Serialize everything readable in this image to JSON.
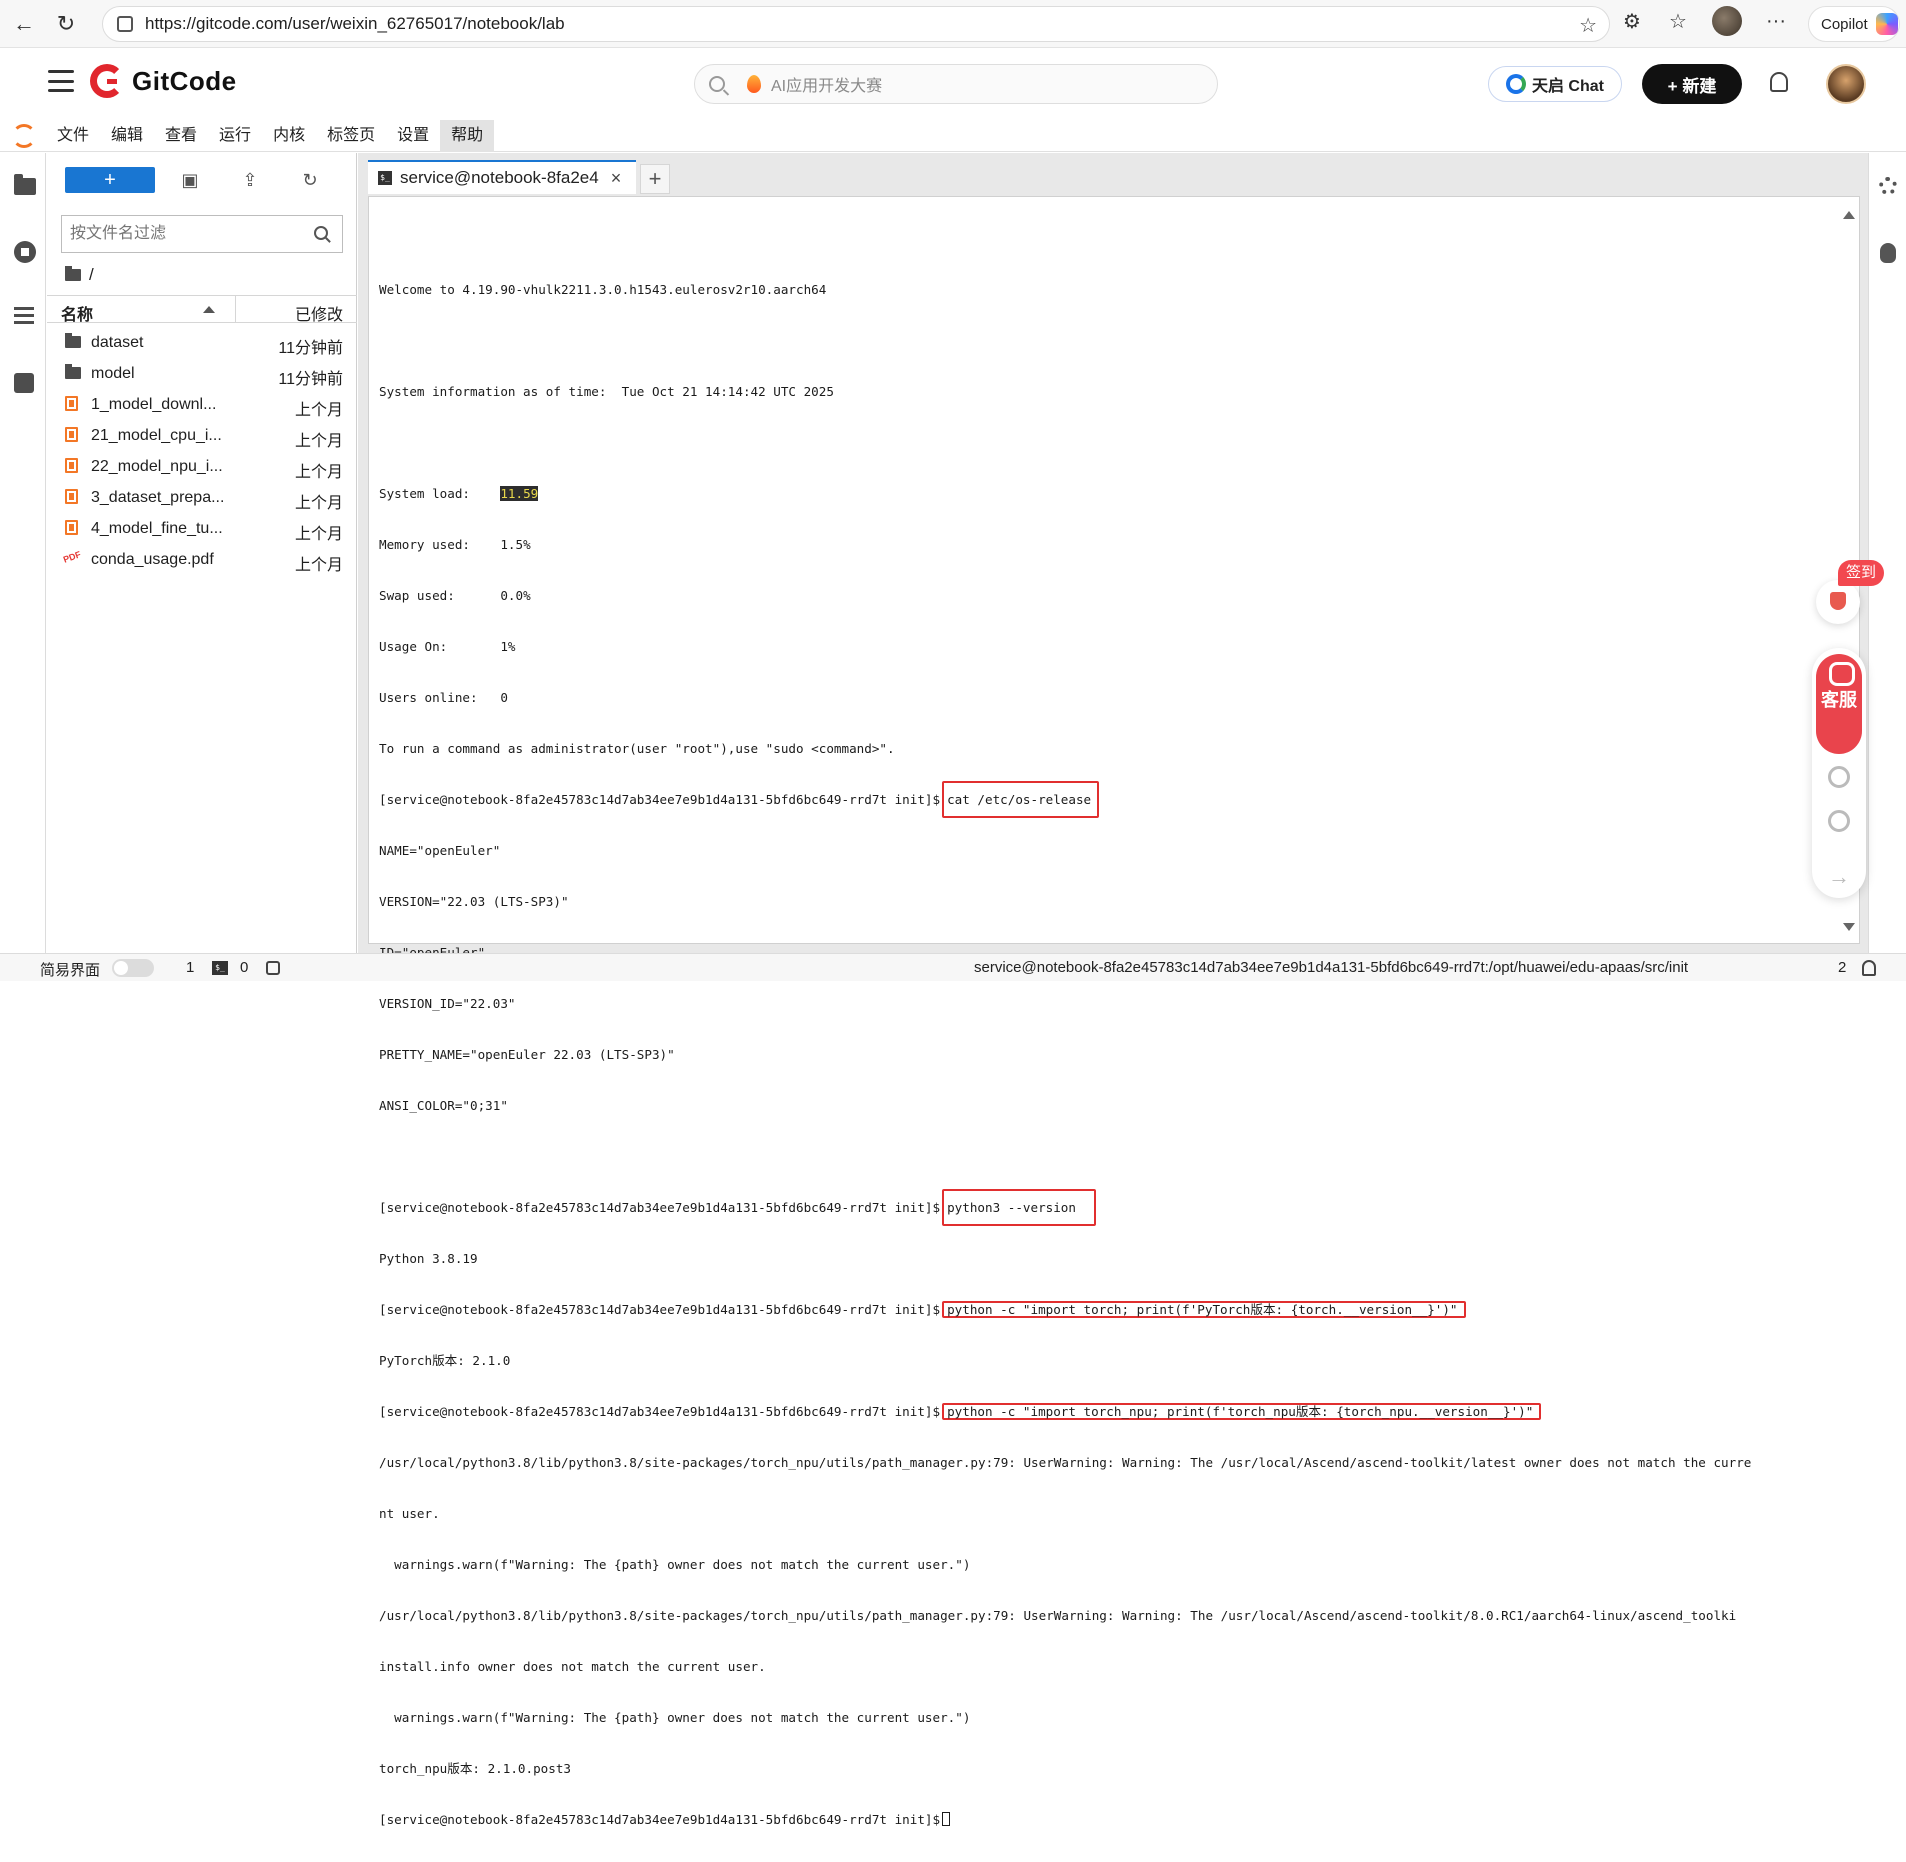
{
  "browser": {
    "url": "https://gitcode.com/user/weixin_62765017/notebook/lab",
    "copilot_label": "Copilot"
  },
  "header": {
    "logo_text": "GitCode",
    "search_placeholder": "AI应用开发大赛",
    "chat_button": "天启 Chat",
    "new_button": "+ 新建"
  },
  "menubar": {
    "items": [
      "文件",
      "编辑",
      "查看",
      "运行",
      "内核",
      "标签页",
      "设置",
      "帮助"
    ]
  },
  "file_browser": {
    "filter_placeholder": "按文件名过滤",
    "path": "/",
    "col_name": "名称",
    "col_modified": "已修改",
    "files": [
      {
        "name": "dataset",
        "modified": "11分钟前",
        "type": "folder"
      },
      {
        "name": "model",
        "modified": "11分钟前",
        "type": "folder"
      },
      {
        "name": "1_model_downl...",
        "modified": "上个月",
        "type": "notebook"
      },
      {
        "name": "21_model_cpu_i...",
        "modified": "上个月",
        "type": "notebook"
      },
      {
        "name": "22_model_npu_i...",
        "modified": "上个月",
        "type": "notebook"
      },
      {
        "name": "3_dataset_prepa...",
        "modified": "上个月",
        "type": "notebook"
      },
      {
        "name": "4_model_fine_tu...",
        "modified": "上个月",
        "type": "notebook"
      },
      {
        "name": "conda_usage.pdf",
        "modified": "上个月",
        "type": "pdf"
      }
    ]
  },
  "tab": {
    "label": "service@notebook-8fa2e4",
    "close": "×",
    "add": "+"
  },
  "terminal": {
    "welcome": "Welcome to 4.19.90-vhulk2211.3.0.h1543.eulerosv2r10.aarch64",
    "sysinfo": "System information as of time:  Tue Oct 21 14:14:42 UTC 2025",
    "load_label": "System load:\t",
    "load_value": "11.59",
    "memory": "Memory used:\t1.5%",
    "swap": "Swap used:\t0.0%",
    "usage": "Usage On:\t1%",
    "users": "Users online:\t0",
    "admin_hint": "To run a command as administrator(user \"root\"),use \"sudo <command>\".",
    "prompt": "[service@notebook-8fa2e45783c14d7ab34ee7e9b1d4a131-5bfd6bc649-rrd7t init]$",
    "cmd1": "cat /etc/os-release",
    "os_lines": [
      "NAME=\"openEuler\"",
      "VERSION=\"22.03 (LTS-SP3)\"",
      "ID=\"openEuler\"",
      "VERSION_ID=\"22.03\"",
      "PRETTY_NAME=\"openEuler 22.03 (LTS-SP3)\"",
      "ANSI_COLOR=\"0;31\""
    ],
    "cmd2": "python3 --version",
    "python_version": "Python 3.8.19",
    "cmd3": "python -c \"import torch; print(f'PyTorch版本: {torch.__version__}')\"",
    "torch_version": "PyTorch版本: 2.1.0",
    "cmd4": "python -c \"import torch_npu; print(f'torch_npu版本: {torch_npu.__version__}')\"",
    "warn1a": "/usr/local/python3.8/lib/python3.8/site-packages/torch_npu/utils/path_manager.py:79: UserWarning: Warning: The /usr/local/Ascend/ascend-toolkit/latest owner does not match the curre",
    "warn1b": "nt user.",
    "warn1c": "  warnings.warn(f\"Warning: The {path} owner does not match the current user.\")",
    "warn2a": "/usr/local/python3.8/lib/python3.8/site-packages/torch_npu/utils/path_manager.py:79: UserWarning: Warning: The /usr/local/Ascend/ascend-toolkit/8.0.RC1/aarch64-linux/ascend_toolki",
    "warn2b": "install.info owner does not match the current user.",
    "warn2c": "  warnings.warn(f\"Warning: The {path} owner does not match the current user.\")",
    "npu_version": "torch_npu版本: 2.1.0.post3"
  },
  "widgets": {
    "qiandao": "签到",
    "kefu": "客服"
  },
  "status": {
    "simple_mode": "简易界面",
    "count1": "1",
    "count2": "0",
    "path": "service@notebook-8fa2e45783c14d7ab34ee7e9b1d4a131-5bfd6bc649-rrd7t:/opt/huawei/edu-apaas/src/init",
    "right_count": "2"
  }
}
